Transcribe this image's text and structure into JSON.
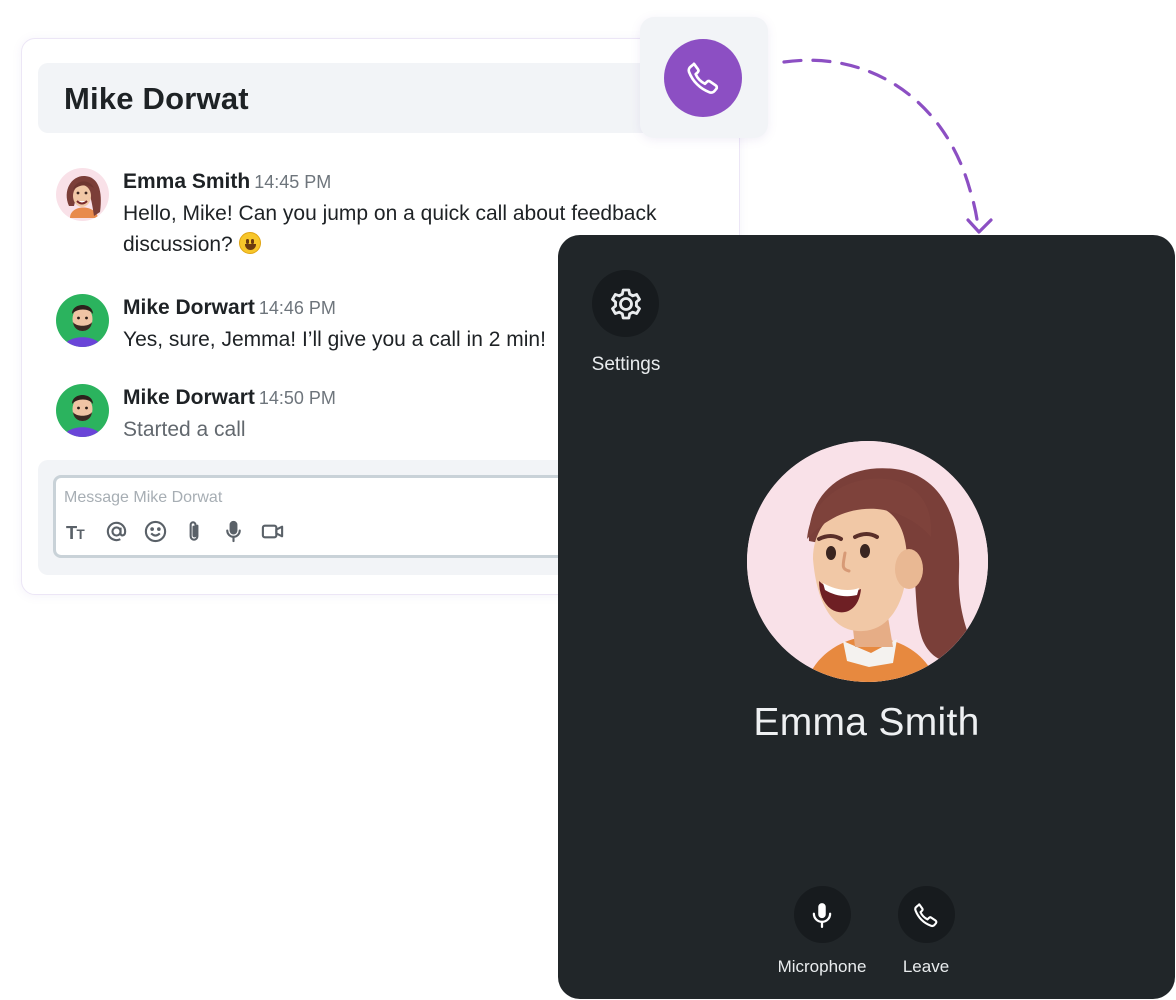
{
  "chat": {
    "title": "Mike Dorwat",
    "messages": [
      {
        "author": "Emma Smith",
        "time": "14:45 PM",
        "text_line1": "Hello, Mike! Can you jump on a quick call about feedback",
        "text_line2": "discussion?",
        "emoji": "grinning-face"
      },
      {
        "author": "Mike Dorwart",
        "time": "14:46 PM",
        "text": "Yes, sure, Jemma! I’ll give you a call in 2 min!"
      },
      {
        "author": "Mike Dorwart",
        "time": "14:50 PM",
        "text": "Started a call"
      }
    ],
    "composer": {
      "placeholder": "Message Mike Dorwat",
      "value": "",
      "tools": [
        "text-format-icon",
        "mention-icon",
        "emoji-icon",
        "attach-icon",
        "microphone-icon",
        "video-icon"
      ]
    }
  },
  "call": {
    "settings_label": "Settings",
    "caller_name": "Emma Smith",
    "microphone_label": "Microphone",
    "leave_label": "Leave"
  },
  "colors": {
    "accent_purple": "#8c4fc3",
    "panel_bg": "#212629",
    "button_bg": "#171b1e",
    "header_bg": "#f2f4f7"
  }
}
